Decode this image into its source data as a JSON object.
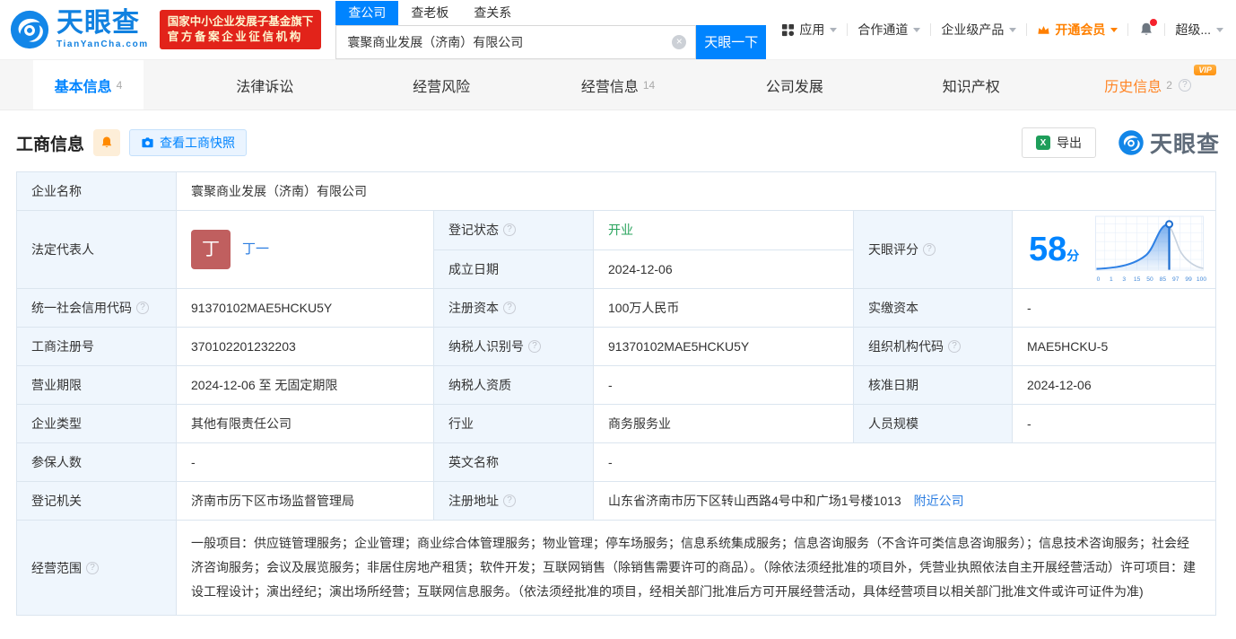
{
  "header": {
    "logo": {
      "brand": "天眼查",
      "domain": "TianYanCha.com"
    },
    "badge": {
      "line1": "国家中小企业发展子基金旗下",
      "line2": "官方备案企业征信机构"
    },
    "search": {
      "tabs": [
        {
          "label": "查公司"
        },
        {
          "label": "查老板"
        },
        {
          "label": "查关系"
        }
      ],
      "value": "寰聚商业发展（济南）有限公司",
      "button_label": "天眼一下"
    },
    "nav": {
      "apps": "应用",
      "cooperation": "合作通道",
      "enterprise": "企业级产品",
      "vip": "开通会员",
      "more": "超级..."
    }
  },
  "tabs": [
    {
      "label": "基本信息",
      "count": "4"
    },
    {
      "label": "法律诉讼",
      "count": ""
    },
    {
      "label": "经营风险",
      "count": ""
    },
    {
      "label": "经营信息",
      "count": "14"
    },
    {
      "label": "公司发展",
      "count": ""
    },
    {
      "label": "知识产权",
      "count": ""
    },
    {
      "label": "历史信息",
      "count": "2",
      "vip_tag": "VIP"
    }
  ],
  "section": {
    "title": "工商信息",
    "snapshot_button": "查看工商快照",
    "export_button": "导出",
    "watermark_brand": "天眼查"
  },
  "fields": {
    "company_name": {
      "label": "企业名称",
      "value": "寰聚商业发展（济南）有限公司"
    },
    "legal_rep": {
      "label": "法定代表人",
      "avatar_char": "丁",
      "name": "丁一"
    },
    "reg_status": {
      "label": "登记状态",
      "value": "开业"
    },
    "establish_date": {
      "label": "成立日期",
      "value": "2024-12-06"
    },
    "score": {
      "label": "天眼评分",
      "value": "58",
      "unit": "分"
    },
    "credit_code": {
      "label": "统一社会信用代码",
      "value": "91370102MAE5HCKU5Y"
    },
    "reg_capital": {
      "label": "注册资本",
      "value": "100万人民币"
    },
    "paid_capital": {
      "label": "实缴资本",
      "value": "-"
    },
    "reg_number": {
      "label": "工商注册号",
      "value": "370102201232203"
    },
    "taxpayer_id": {
      "label": "纳税人识别号",
      "value": "91370102MAE5HCKU5Y"
    },
    "org_code": {
      "label": "组织机构代码",
      "value": "MAE5HCKU-5"
    },
    "business_term": {
      "label": "营业期限",
      "value": "2024-12-06 至 无固定期限"
    },
    "taxpayer_quality": {
      "label": "纳税人资质",
      "value": "-"
    },
    "approval_date": {
      "label": "核准日期",
      "value": "2024-12-06"
    },
    "company_type": {
      "label": "企业类型",
      "value": "其他有限责任公司"
    },
    "industry": {
      "label": "行业",
      "value": "商务服务业"
    },
    "staff_size": {
      "label": "人员规模",
      "value": "-"
    },
    "insured_count": {
      "label": "参保人数",
      "value": "-"
    },
    "english_name": {
      "label": "英文名称",
      "value": "-"
    },
    "reg_authority": {
      "label": "登记机关",
      "value": "济南市历下区市场监督管理局"
    },
    "reg_address": {
      "label": "注册地址",
      "value": "山东省济南市历下区转山西路4号中和广场1号楼1013",
      "nearby_link": "附近公司"
    },
    "business_scope": {
      "label": "经营范围",
      "value": "一般项目：供应链管理服务；企业管理；商业综合体管理服务；物业管理；停车场服务；信息系统集成服务；信息咨询服务（不含许可类信息咨询服务）；信息技术咨询服务；社会经济咨询服务；会议及展览服务；非居住房地产租赁；软件开发；互联网销售（除销售需要许可的商品）。（除依法须经批准的项目外，凭营业执照依法自主开展经营活动）许可项目：建设工程设计；演出经纪；演出场所经营；互联网信息服务。（依法须经批准的项目，经相关部门批准后方可开展经营活动，具体经营项目以相关部门批准文件或许可证件为准)"
    }
  },
  "score_chart": {
    "type": "area",
    "score": 58,
    "unit": "分",
    "x_ticks": [
      "0",
      "1",
      "3",
      "15",
      "50",
      "85",
      "97",
      "99",
      "100"
    ],
    "accent_color": "#2f81e5",
    "grid": true
  },
  "colors": {
    "primary_blue": "#0084ff",
    "link_blue": "#2b7de1",
    "status_green": "#28a35c",
    "vip_orange": "#ff8000",
    "badge_red": "#e2231a",
    "label_cell_bg": "#eff6fd"
  }
}
